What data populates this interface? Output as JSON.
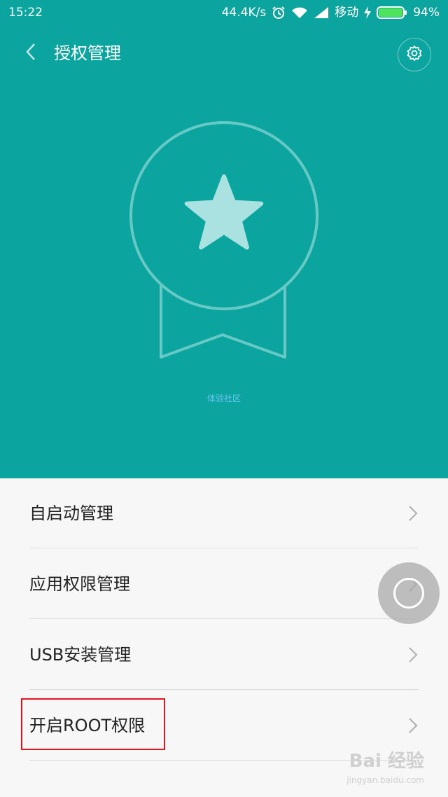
{
  "status_bar": {
    "time": "15:22",
    "network_speed": "44.4K/s",
    "carrier": "移动",
    "battery": "94%",
    "icons": [
      "alarm-icon",
      "wifi-icon",
      "signal-icon",
      "charging-icon",
      "battery-icon"
    ]
  },
  "header": {
    "title": "授权管理",
    "back_icon": "back-icon",
    "settings_icon": "gear-icon"
  },
  "hero": {
    "badge_icon": "ribbon-star-icon",
    "watermark": "体验社区"
  },
  "menu": {
    "items": [
      {
        "label": "自启动管理"
      },
      {
        "label": "应用权限管理"
      },
      {
        "label": "USB安装管理"
      },
      {
        "label": "开启ROOT权限"
      }
    ]
  },
  "watermark": {
    "brand": "Bai 经验",
    "url": "jingyan.baidu.com"
  },
  "colors": {
    "hero_bg": "#0ba49f",
    "highlight_border": "#e0161e"
  }
}
